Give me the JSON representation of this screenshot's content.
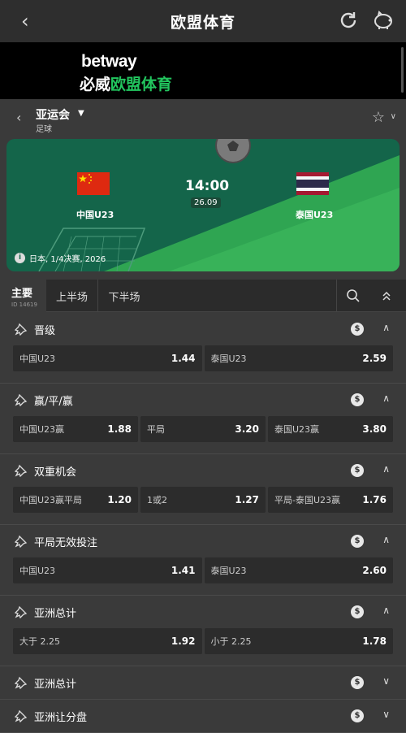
{
  "header": {
    "title": "欧盟体育",
    "back_icon": "chevron-left-icon",
    "refresh_icon": "refresh-icon",
    "piggy_icon": "piggy-bank-icon"
  },
  "banner": {
    "brand": "betway",
    "sub_white": "必威",
    "sub_green": "欧盟体育"
  },
  "league": {
    "name": "亚运会",
    "sport": "足球"
  },
  "match": {
    "home": "中国U23",
    "away": "泰国U23",
    "time": "14:00",
    "date": "26.09",
    "info": "日本, 1/4决赛, 2026"
  },
  "tabs": {
    "main": "主要",
    "id": "ID 14619",
    "first_half": "上半场",
    "second_half": "下半场"
  },
  "markets": [
    {
      "title": "晋级",
      "expanded": true,
      "odds": [
        {
          "label": "中国U23",
          "value": "1.44"
        },
        {
          "label": "泰国U23",
          "value": "2.59"
        }
      ]
    },
    {
      "title": "赢/平/赢",
      "expanded": true,
      "odds": [
        {
          "label": "中国U23赢",
          "value": "1.88"
        },
        {
          "label": "平局",
          "value": "3.20"
        },
        {
          "label": "泰国U23赢",
          "value": "3.80"
        }
      ]
    },
    {
      "title": "双重机会",
      "expanded": true,
      "odds": [
        {
          "label": "中国U23赢平局",
          "value": "1.20"
        },
        {
          "label": "1或2",
          "value": "1.27"
        },
        {
          "label": "平局-泰国U23赢",
          "value": "1.76"
        }
      ]
    },
    {
      "title": "平局无效投注",
      "expanded": true,
      "odds": [
        {
          "label": "中国U23",
          "value": "1.41"
        },
        {
          "label": "泰国U23",
          "value": "2.60"
        }
      ]
    },
    {
      "title": "亚洲总计",
      "expanded": true,
      "odds": [
        {
          "label": "大于 2.25",
          "value": "1.92"
        },
        {
          "label": "小于 2.25",
          "value": "1.78"
        }
      ]
    },
    {
      "title": "亚洲总计",
      "expanded": false,
      "odds": []
    },
    {
      "title": "亚洲让分盘",
      "expanded": false,
      "odds": []
    }
  ],
  "colors": {
    "accent_green": "#22c55e",
    "card_green": "#14654a",
    "bg": "#3a3a3a"
  }
}
